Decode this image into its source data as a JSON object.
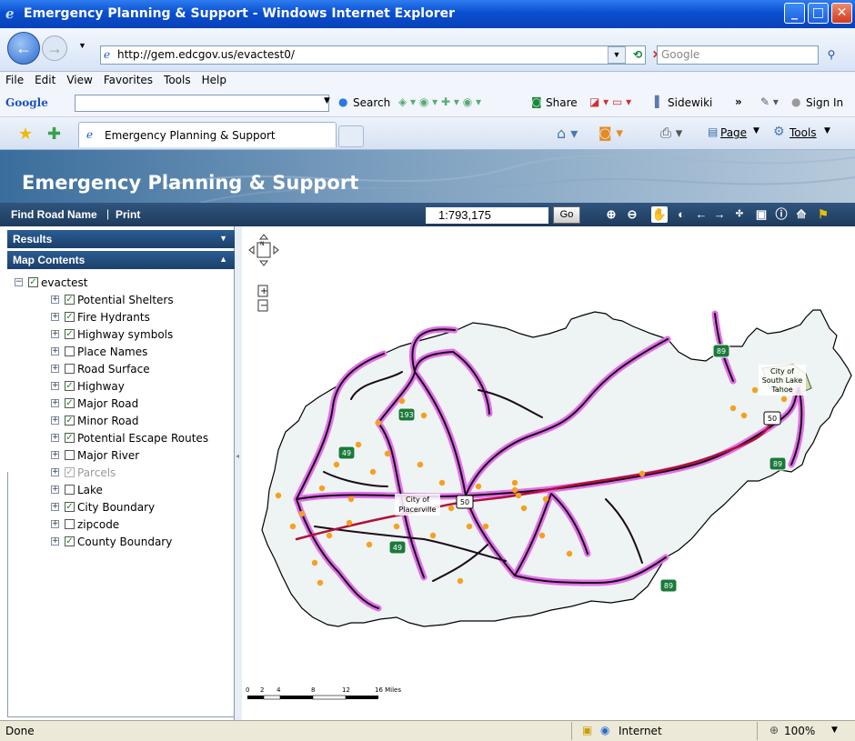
{
  "window": {
    "title": "Emergency Planning & Support - Windows Internet Explorer"
  },
  "browser": {
    "url": "http://gem.edcgov.us/evactest0/",
    "search_placeholder": "Google",
    "menu": [
      "File",
      "Edit",
      "View",
      "Favorites",
      "Tools",
      "Help"
    ],
    "google_toolbar": {
      "logo": "Google",
      "search_label": "Search",
      "share_label": "Share",
      "sidewiki_label": "Sidewiki",
      "more_label": "»",
      "signin_label": "Sign In"
    },
    "tab_title": "Emergency Planning & Support",
    "page_menu": "Page",
    "tools_menu": "Tools"
  },
  "app": {
    "title": "Emergency Planning & Support",
    "toolbar": {
      "find_road": "Find Road Name",
      "separator": "|",
      "print": "Print",
      "scale": "1:793,175",
      "go": "Go"
    }
  },
  "panel": {
    "results_title": "Results",
    "map_contents_title": "Map Contents",
    "root": {
      "label": "evactest",
      "checked": true
    },
    "layers": [
      {
        "label": "Potential Shelters",
        "checked": true,
        "disabled": false
      },
      {
        "label": "Fire Hydrants",
        "checked": true,
        "disabled": false
      },
      {
        "label": "Highway symbols",
        "checked": true,
        "disabled": false
      },
      {
        "label": "Place Names",
        "checked": false,
        "disabled": false
      },
      {
        "label": "Road Surface",
        "checked": false,
        "disabled": false
      },
      {
        "label": "Highway",
        "checked": true,
        "disabled": false
      },
      {
        "label": "Major Road",
        "checked": true,
        "disabled": false
      },
      {
        "label": "Minor Road",
        "checked": true,
        "disabled": false
      },
      {
        "label": "Potential Escape Routes",
        "checked": true,
        "disabled": false
      },
      {
        "label": "Major River",
        "checked": false,
        "disabled": false
      },
      {
        "label": "Parcels",
        "checked": true,
        "disabled": true
      },
      {
        "label": "Lake",
        "checked": false,
        "disabled": false
      },
      {
        "label": "City Boundary",
        "checked": true,
        "disabled": false
      },
      {
        "label": "zipcode",
        "checked": false,
        "disabled": false
      },
      {
        "label": "County Boundary",
        "checked": true,
        "disabled": false
      }
    ]
  },
  "map": {
    "places": [
      {
        "line1": "City of",
        "line2": "Placerville"
      },
      {
        "line1": "City of",
        "line2": "South Lake"
      },
      {
        "line3": "Tahoe"
      }
    ],
    "shields": [
      "193",
      "49",
      "50",
      "49",
      "89",
      "89",
      "50",
      "89"
    ],
    "scalebar": {
      "ticks": [
        "0",
        "2",
        "4",
        "8",
        "12",
        "16 Miles"
      ]
    },
    "colors": {
      "escape_route": "#e070e8",
      "road": "#1a0a1a",
      "highway": "#b0103a",
      "hydrant": "#f5a020",
      "county_fill": "#eef3f3",
      "shield": "#1b7a3a"
    }
  },
  "status": {
    "text": "Done",
    "zone": "Internet",
    "zoom": "100%"
  }
}
